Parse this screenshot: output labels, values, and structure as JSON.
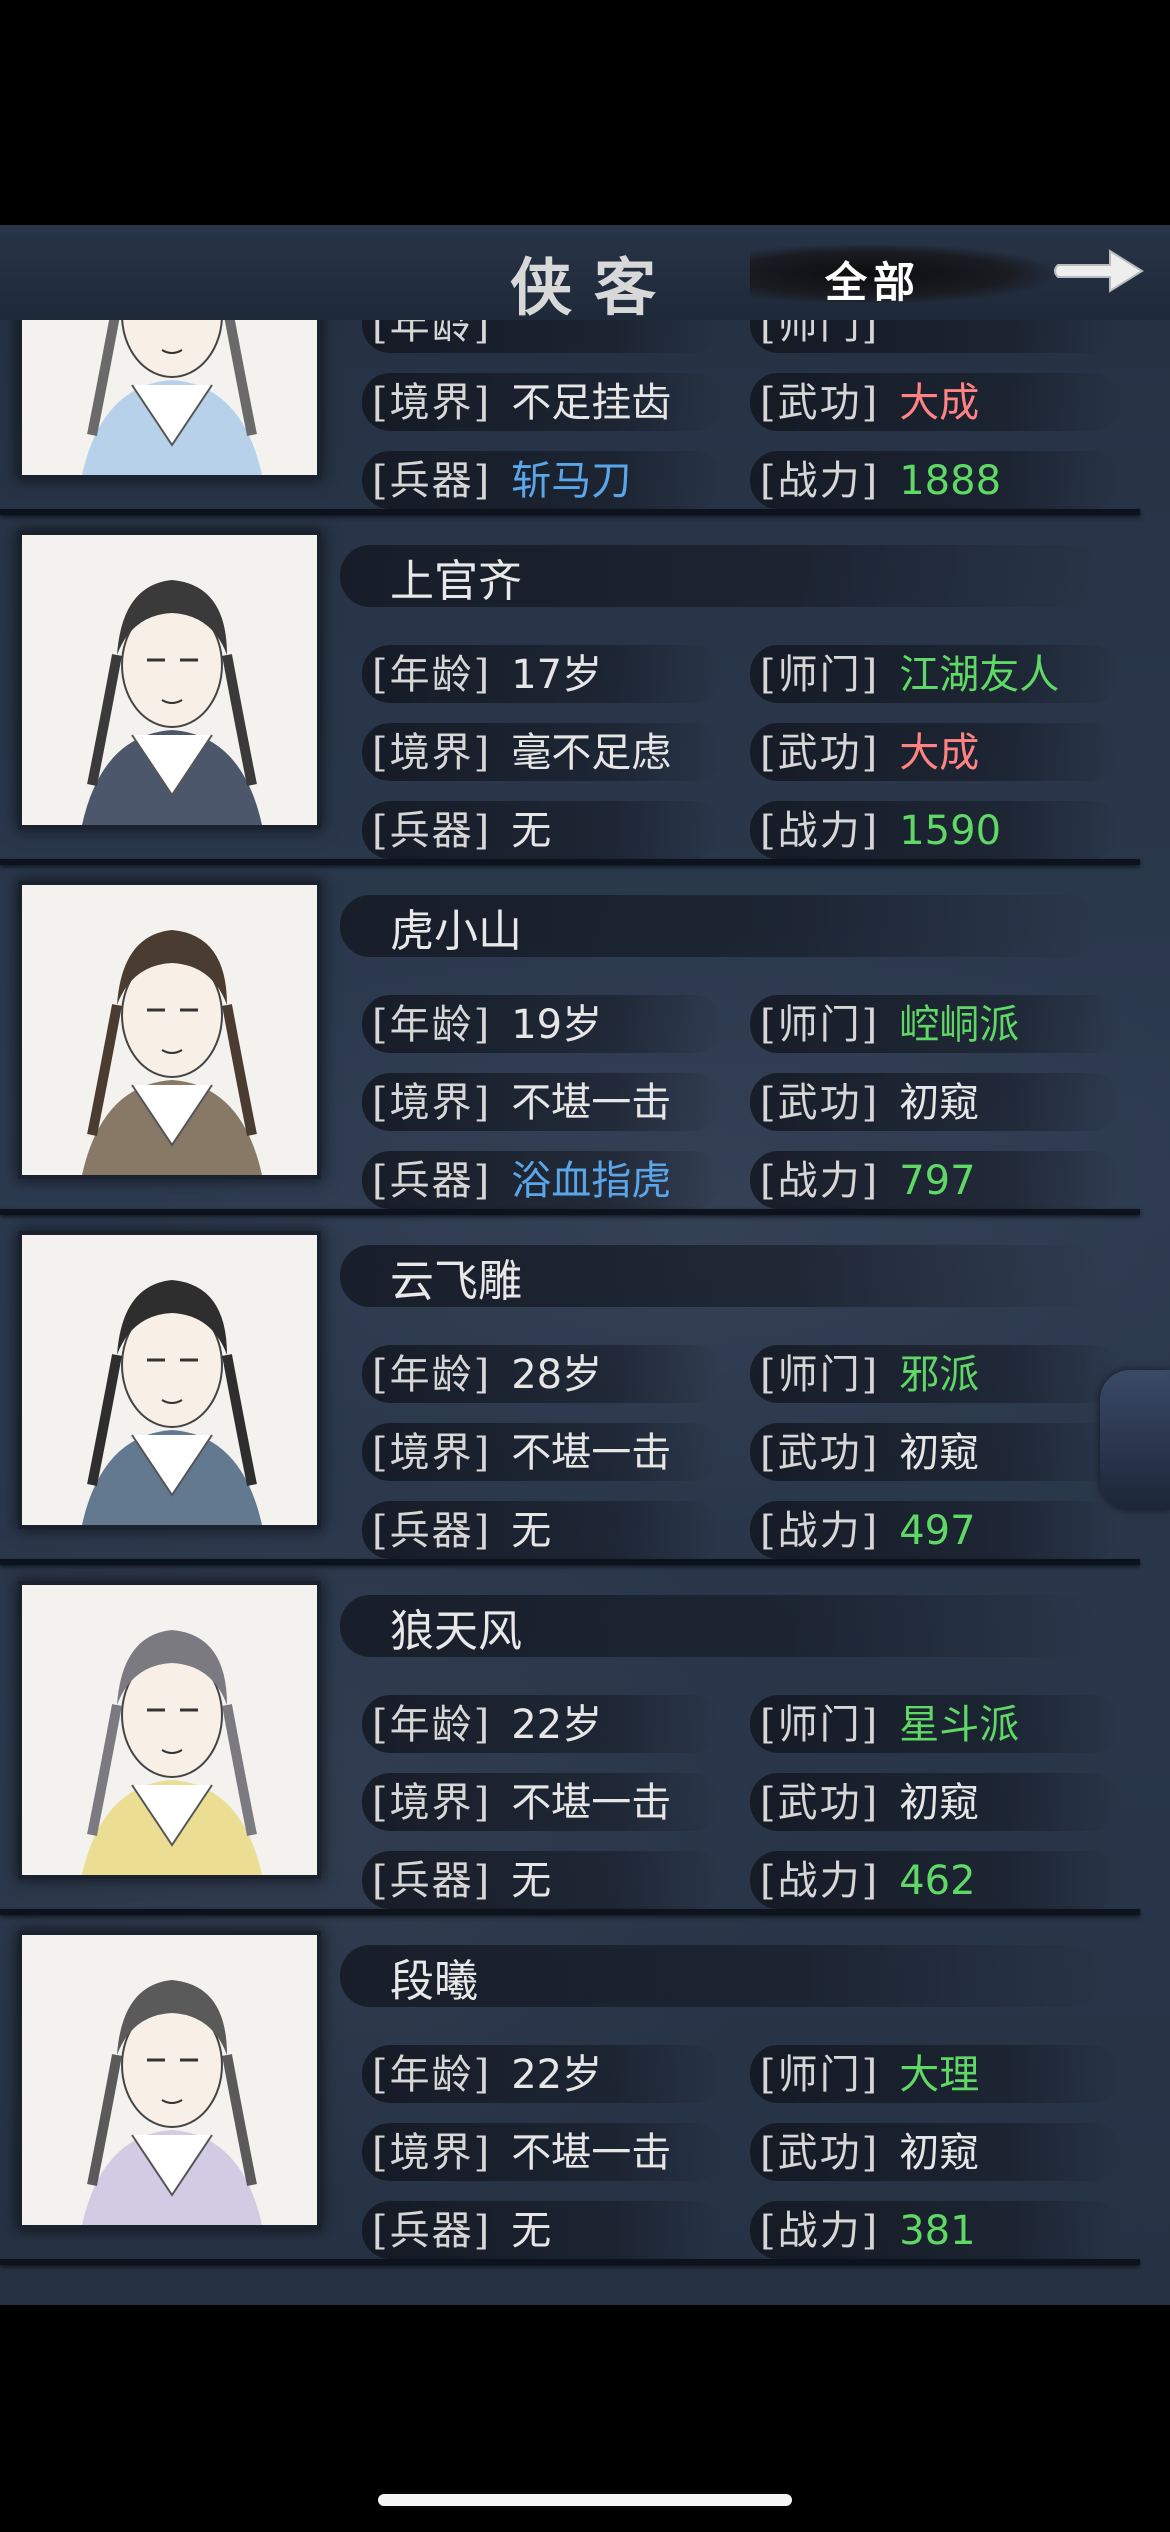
{
  "header": {
    "title": "侠客",
    "filter_label": "全部",
    "next_icon": "arrow-right-icon"
  },
  "rows": [
    {
      "name": "",
      "age": "",
      "sect": "",
      "realm": "不足挂齿",
      "martial": "大成",
      "weapon": "斩马刀",
      "power": "1888",
      "martial_color": "#ff8383",
      "weapon_color": "#5aa6e8",
      "sect_color": "#5fd866"
    },
    {
      "name": "上官齐",
      "age": "17岁",
      "sect": "江湖友人",
      "realm": "毫不足虑",
      "martial": "大成",
      "weapon": "无",
      "power": "1590",
      "martial_color": "#ff8383",
      "weapon_color": "#e6e6e6",
      "sect_color": "#5fd866"
    },
    {
      "name": "虎小山",
      "age": "19岁",
      "sect": "崆峒派",
      "realm": "不堪一击",
      "martial": "初窥",
      "weapon": "浴血指虎",
      "power": "797",
      "martial_color": "#e6e6e6",
      "weapon_color": "#5aa6e8",
      "sect_color": "#5fd866"
    },
    {
      "name": "云飞雕",
      "age": "28岁",
      "sect": "邪派",
      "realm": "不堪一击",
      "martial": "初窥",
      "weapon": "无",
      "power": "497",
      "martial_color": "#e6e6e6",
      "weapon_color": "#e6e6e6",
      "sect_color": "#5fd866"
    },
    {
      "name": "狼天风",
      "age": "22岁",
      "sect": "星斗派",
      "realm": "不堪一击",
      "martial": "初窥",
      "weapon": "无",
      "power": "462",
      "martial_color": "#e6e6e6",
      "weapon_color": "#e6e6e6",
      "sect_color": "#5fd866"
    },
    {
      "name": "段曦",
      "age": "22岁",
      "sect": "大理",
      "realm": "不堪一击",
      "martial": "初窥",
      "weapon": "无",
      "power": "381",
      "martial_color": "#e6e6e6",
      "weapon_color": "#e6e6e6",
      "sect_color": "#5fd866"
    }
  ],
  "labels": {
    "age": "[年龄]",
    "realm": "[境界]",
    "weapon": "[兵器]",
    "sect": "[师门]",
    "martial": "[武功]",
    "power": "[战力]"
  },
  "colors": {
    "power": "#5fd866"
  }
}
